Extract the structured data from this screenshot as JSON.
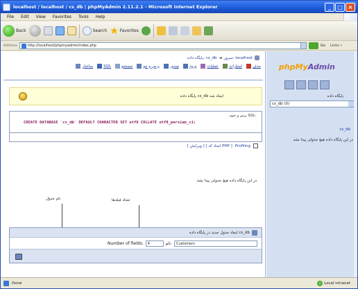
{
  "window": {
    "title": "localhost / localhost / cs_db | phpMyAdmin 2.11.2.1 - Microsoft Internet Explorer",
    "controls": [
      "_",
      "□",
      "×"
    ]
  },
  "menu": [
    "File",
    "Edit",
    "View",
    "Favorites",
    "Tools",
    "Help"
  ],
  "toolbar": {
    "back": "Back",
    "search": "Search",
    "favorites": "Favorites"
  },
  "address": {
    "label": "Address",
    "url": "http://localhost/phpmyadmin/index.php",
    "go": "Go",
    "links": "Links »"
  },
  "breadcrumb": {
    "server": "سرور: localhost",
    "database": "پایگاه داده: cs_db"
  },
  "tabs": [
    "ساختار",
    "SQL",
    "جستجو",
    "پرس و جو",
    "صدور",
    "ورود",
    "عملیات",
    "امتیازات",
    "حذف"
  ],
  "notice": "پایگاه داده cs_db ایجاد شد",
  "sql": {
    "label": "پرس و جوی SQL:",
    "query": "CREATE DATABASE `cs_db` DEFAULT CHARACTER SET utf8 COLLATE utf8_persian_ci;",
    "profiling": "Profiling",
    "links": "[ ویرایش ] [ ایجاد کد PHP ]"
  },
  "section": "در این پایگاه داده هیچ جدولی پیدا نشد",
  "callouts": {
    "table_name": "نام جدول",
    "fields_count": "تعداد فیلدها"
  },
  "create_table": {
    "header": "ایجاد جدول جدید در پایگاه داده cs_db",
    "name_label": "نام:",
    "name_value": "Customers",
    "fields_label": "Number of fields:",
    "fields_value": "4"
  },
  "sidebar": {
    "logo_a": "phpMy",
    "logo_b": "Admin",
    "db_label": "پایگاه داده",
    "db_selected": "cs_db (0)",
    "db_link": "cs_db",
    "db_note": "در این پایگاه داده هیچ جدولی پیدا نشد"
  },
  "status": {
    "text": "Done",
    "zone": "Local intranet"
  }
}
